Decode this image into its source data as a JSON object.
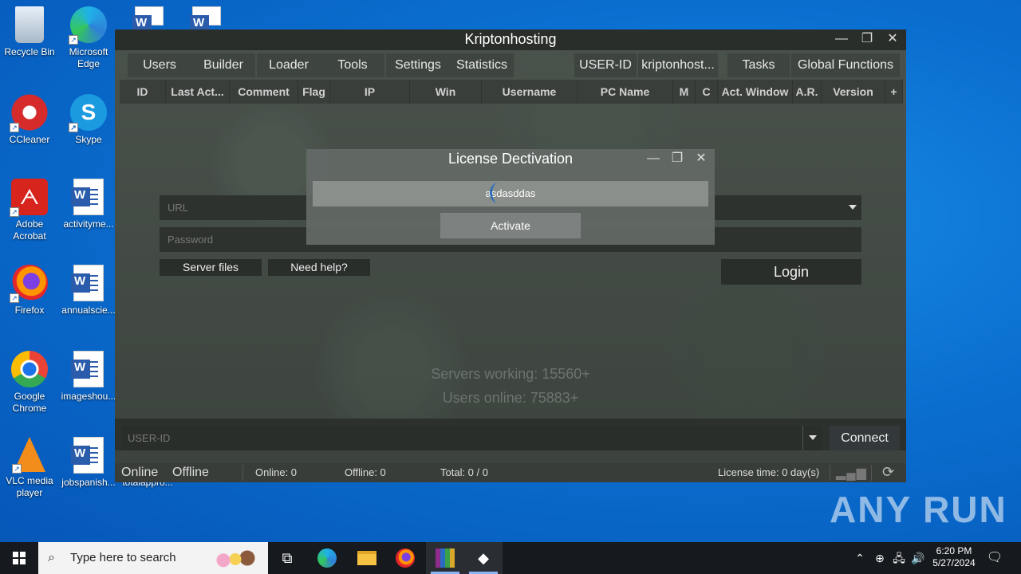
{
  "desktop": {
    "icons": [
      {
        "label": "Recycle Bin",
        "icon": "recycle-bin-icon"
      },
      {
        "label": "Microsoft Edge",
        "icon": "edge-icon"
      },
      {
        "label": "CCleaner",
        "icon": "ccleaner-icon"
      },
      {
        "label": "Skype",
        "icon": "skype-icon"
      },
      {
        "label": "Adobe Acrobat",
        "icon": "acrobat-icon"
      },
      {
        "label": "activityme...",
        "icon": "word-doc-icon"
      },
      {
        "label": "Firefox",
        "icon": "firefox-icon"
      },
      {
        "label": "annualscie...",
        "icon": "word-doc-icon"
      },
      {
        "label": "Google Chrome",
        "icon": "chrome-icon"
      },
      {
        "label": "imageshou...",
        "icon": "word-doc-icon"
      },
      {
        "label": "VLC media player",
        "icon": "vlc-icon"
      },
      {
        "label": "jobspanish...",
        "icon": "word-doc-icon"
      },
      {
        "label": "totalappro...",
        "icon": "word-doc-icon"
      }
    ]
  },
  "app": {
    "title": "Kriptonhosting",
    "menu": [
      "Users",
      "Builder",
      "Loader",
      "Tools",
      "Settings",
      "Statistics",
      "USER-ID",
      "kriptonhost...",
      "Tasks",
      "Global Functions"
    ],
    "columns": [
      "ID",
      "Last Act...",
      "Comment",
      "Flag",
      "IP",
      "Win",
      "Username",
      "PC Name",
      "M",
      "C",
      "Act. Window",
      "A.R.",
      "Version",
      "+"
    ],
    "url_placeholder": "URL",
    "password_placeholder": "Password",
    "server_files": "Server files",
    "need_help": "Need help?",
    "login": "Login",
    "servers_working": "Servers working: 15560+",
    "users_online": "Users online: 75883+",
    "userid_placeholder": "USER-ID",
    "connect": "Connect",
    "status": {
      "online_tab": "Online",
      "offline_tab": "Offline",
      "online_count": "Online: 0",
      "offline_count": "Offline: 0",
      "total": "Total: 0 / 0",
      "license_time": "License time: 0 day(s)"
    }
  },
  "dialog": {
    "title": "License Dectivation",
    "key_value": "asdasddas",
    "activate": "Activate"
  },
  "taskbar": {
    "search_placeholder": "Type here to search",
    "time": "6:20 PM",
    "date": "5/27/2024"
  },
  "watermark": "ANY RUN"
}
